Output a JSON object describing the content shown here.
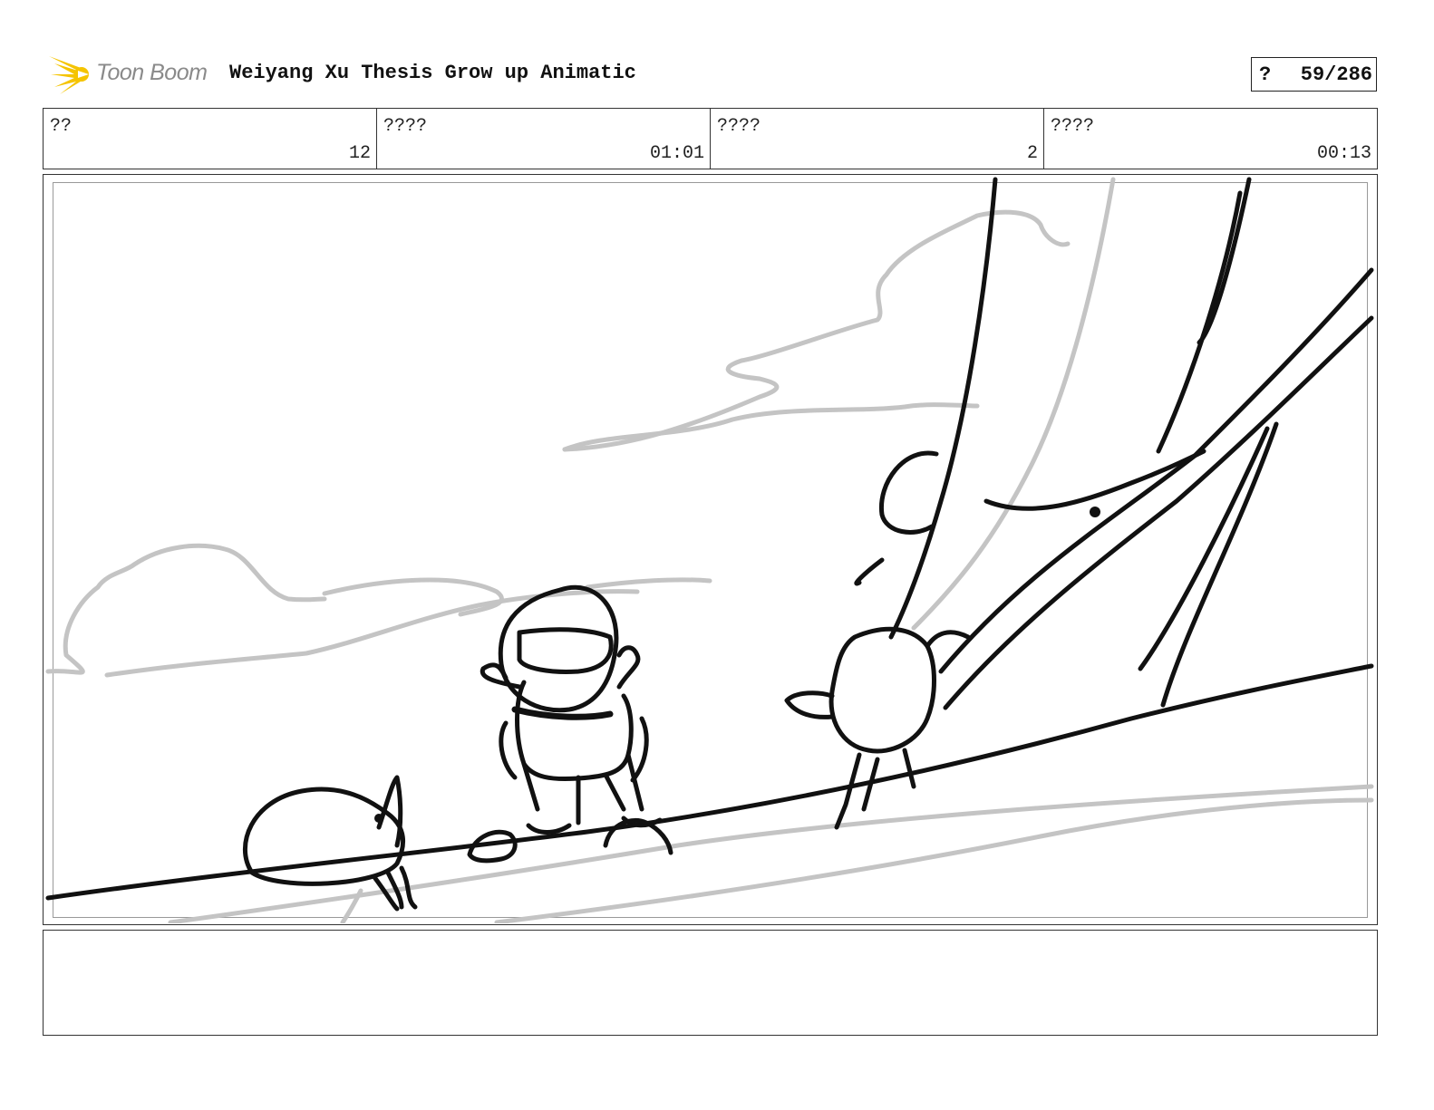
{
  "header": {
    "logo_text": "Toon Boom",
    "title": "Weiyang Xu Thesis Grow up Animatic",
    "page_prefix": "?",
    "page_number": "59/286"
  },
  "info_cells": [
    {
      "label": "??",
      "value": "12"
    },
    {
      "label": "????",
      "value": "01:01"
    },
    {
      "label": "????",
      "value": "2"
    },
    {
      "label": "????",
      "value": "00:13"
    }
  ],
  "panel": {
    "icon": "storyboard-sketch"
  },
  "notes": {
    "text": ""
  },
  "colors": {
    "logo_accent": "#f5c400",
    "sketch_black": "#111111",
    "sketch_gray": "#c4c4c4"
  }
}
